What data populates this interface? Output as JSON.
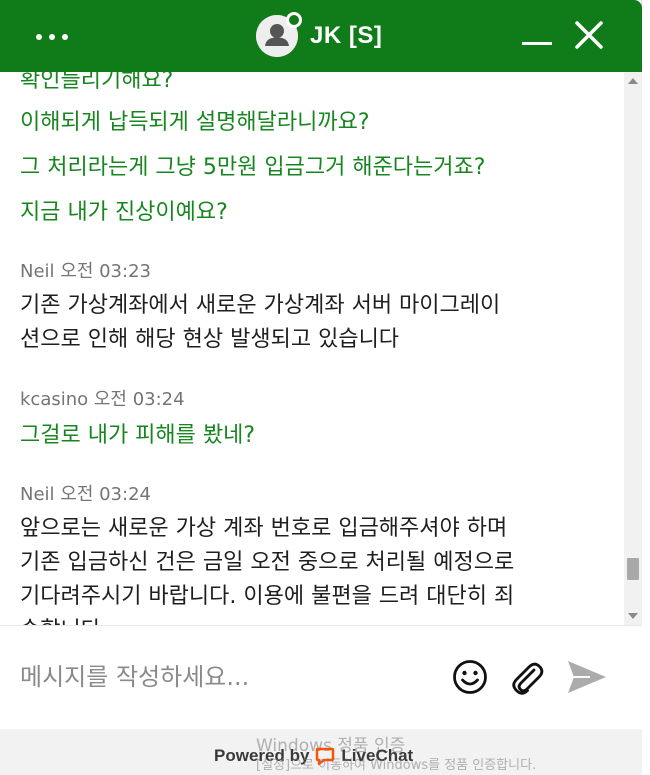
{
  "header": {
    "agent_name": "JK [S]",
    "bg_color": "#0f7c19"
  },
  "messages": {
    "partial_top": "확인들리기해요?",
    "customer_lines_1": [
      "이해되게 납득되게 설명해달라니까요?",
      "그 처리라는게 그냥 5만원 입금그거 해준다는거죠?",
      "지금 내가 진상이예요?"
    ],
    "agent_msg_1": {
      "meta": "Neil 오전 03:23",
      "lines": [
        "기존 가상계좌에서 새로운 가상계좌 서버 마이그레이",
        "션으로 인해 해당 현상 발생되고 있습니다"
      ]
    },
    "customer_msg_2": {
      "meta": "kcasino 오전 03:24",
      "lines": [
        "그걸로 내가 피해를 봤네?"
      ]
    },
    "agent_msg_2": {
      "meta": "Neil 오전 03:24",
      "lines": [
        "앞으로는 새로운 가상 계좌 번호로 입금해주셔야 하며",
        "기존 입금하신 건은 금일 오전 중으로 처리될 예정으로",
        "기다려주시기 바랍니다. 이용에 불편을 드려 대단히 죄",
        "송합니다"
      ]
    }
  },
  "composer": {
    "placeholder": "메시지를 작성하세요..."
  },
  "footer": {
    "powered_by": "Powered by",
    "brand": "LiveChat",
    "watermark_title": "Windows 정품 인증",
    "watermark_sub": "[설정]으로 이동하여 Windows를 정품 인증합니다."
  },
  "colors": {
    "customer_text": "#17861f",
    "agent_text": "#1f1f1f",
    "meta_text": "#757575",
    "logo_orange": "#ff5100"
  },
  "icons": [
    "more-dots-icon",
    "user-avatar-icon",
    "minimize-icon",
    "close-icon",
    "emoji-icon",
    "paperclip-icon",
    "send-icon",
    "livechat-logo-icon"
  ]
}
